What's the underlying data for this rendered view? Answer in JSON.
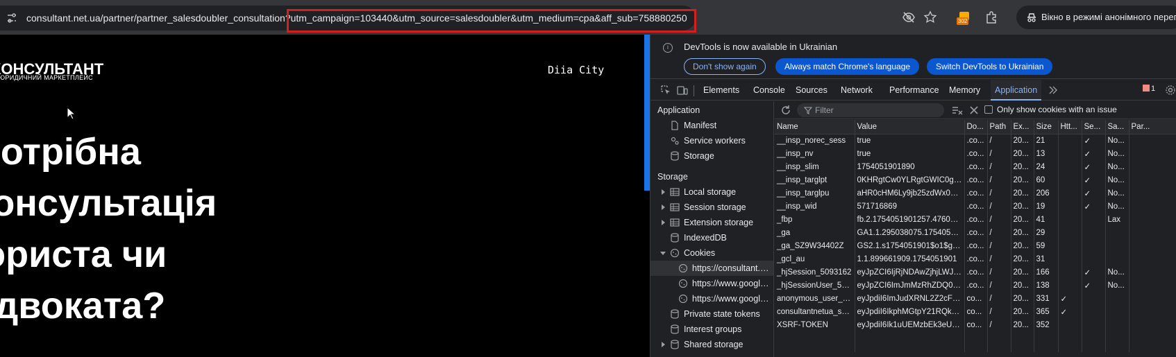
{
  "urlbar": {
    "url_base": "consultant.net.ua/partner/partner_salesdoubler_consultation",
    "url_query": "?utm_campaign=103440&utm_source=salesdoubler&utm_medium=cpa&aff_sub=758880250",
    "extension_badge": "302",
    "incognito_label": "Вікно в режимі анонімного перегляду"
  },
  "page": {
    "logo_title": "КОНСУЛЬТАНТ",
    "logo_subtitle": "ЮРИДИЧНИЙ МАРКЕТПЛЕЙС",
    "diia_label": "Diia  City",
    "hero_lines": [
      "Потрібна",
      "консультація",
      "юриста чи",
      "адвоката?"
    ]
  },
  "devtools": {
    "infobar": {
      "message": "DevTools is now available in Ukrainian",
      "btn_dont_show": "Don't show again",
      "btn_match": "Always match Chrome's language",
      "btn_switch": "Switch DevTools to Ukrainian"
    },
    "tabs": [
      "Elements",
      "Console",
      "Sources",
      "Network",
      "Performance",
      "Memory",
      "Application"
    ],
    "error_count": "1",
    "sidebar": {
      "application_head": "Application",
      "manifest": "Manifest",
      "service_workers": "Service workers",
      "storage_item": "Storage",
      "storage_head": "Storage",
      "local_storage": "Local storage",
      "session_storage": "Session storage",
      "extension_storage": "Extension storage",
      "indexeddb": "IndexedDB",
      "cookies": "Cookies",
      "cookie_origin_1": "https://consultant.net.ua",
      "cookie_origin_2": "https://www.googletagmanager.com",
      "cookie_origin_3": "https://www.google.com",
      "private_state_tokens": "Private state tokens",
      "interest_groups": "Interest groups",
      "shared_storage": "Shared storage"
    },
    "cookies": {
      "filter_placeholder": "Filter",
      "only_issue_label": "Only show cookies with an issue",
      "columns": [
        "Name",
        "Value",
        "Do...",
        "Path",
        "Ex...",
        "Size",
        "Htt...",
        "Se...",
        "Sa...",
        "Par..."
      ],
      "rows": [
        [
          "__insp_norec_sess",
          "true",
          ".co...",
          "/",
          "20...",
          "21",
          "",
          "✓",
          "No...",
          ""
        ],
        [
          "__insp_nv",
          "true",
          ".co...",
          "/",
          "20...",
          "13",
          "",
          "✓",
          "No...",
          ""
        ],
        [
          "__insp_slim",
          "1754051901890",
          ".co...",
          "/",
          "20...",
          "24",
          "",
          "✓",
          "No...",
          ""
        ],
        [
          "__insp_targlpt",
          "0KHRgtCw0YLRgtGWIC0gY2...",
          ".co...",
          "/",
          "20...",
          "60",
          "",
          "✓",
          "No...",
          ""
        ],
        [
          "__insp_targlpu",
          "aHR0cHM6Ly9jb25zdWx0YW...",
          ".co...",
          "/",
          "20...",
          "206",
          "",
          "✓",
          "No...",
          ""
        ],
        [
          "__insp_wid",
          "571716869",
          ".co...",
          "/",
          "20...",
          "19",
          "",
          "✓",
          "No...",
          ""
        ],
        [
          "_fbp",
          "fb.2.1754051901257.476022...",
          ".co...",
          "/",
          "20...",
          "41",
          "",
          "",
          "Lax",
          ""
        ],
        [
          "_ga",
          "GA1.1.295038075.1754051901",
          ".co...",
          "/",
          "20...",
          "29",
          "",
          "",
          "",
          ""
        ],
        [
          "_ga_SZ9W34402Z",
          "GS2.1.s1754051901$o1$g0$t...",
          ".co...",
          "/",
          "20...",
          "59",
          "",
          "",
          "",
          ""
        ],
        [
          "_gcl_au",
          "1.1.899661909.1754051901",
          ".co...",
          "/",
          "20...",
          "31",
          "",
          "",
          "",
          ""
        ],
        [
          "_hjSession_5093162",
          "eyJpZCI6IjRjNDAwZjhjLWJjY2...",
          ".co...",
          "/",
          "20...",
          "166",
          "",
          "✓",
          "No...",
          ""
        ],
        [
          "_hjSessionUser_509...",
          "eyJpZCI6ImJmMzRhZDQ0LW...",
          ".co...",
          "/",
          "20...",
          "138",
          "",
          "✓",
          "No...",
          ""
        ],
        [
          "anonymous_user_d...",
          "eyJpdiI6ImJudXRNL2Z2cFR1...",
          "co...",
          "/",
          "20...",
          "331",
          "✓",
          "",
          "",
          ""
        ],
        [
          "consultantnetua_se...",
          "eyJpdiI6IkphMGtpY21RQkJ3...",
          "co...",
          "/",
          "20...",
          "365",
          "✓",
          "",
          "",
          ""
        ],
        [
          "XSRF-TOKEN",
          "eyJpdiI6Ik1uUEMzbEk3eU8v...",
          "co...",
          "/",
          "20...",
          "352",
          "",
          "",
          "",
          ""
        ]
      ]
    }
  }
}
